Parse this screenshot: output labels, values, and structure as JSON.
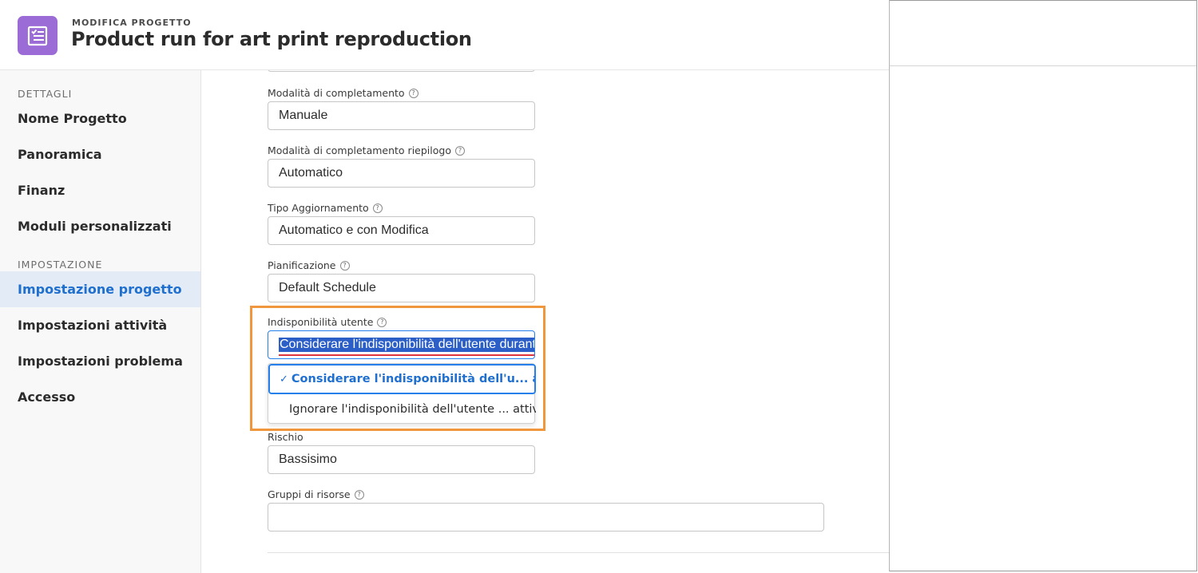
{
  "header": {
    "subtitle": "MODIFICA PROGETTO",
    "title": "Product run for art print reproduction",
    "icon": "task-list-icon",
    "icon_color": "#9b6bd6"
  },
  "sidebar": {
    "sections": [
      {
        "label": "DETTAGLI",
        "items": [
          {
            "label": "Nome Progetto"
          },
          {
            "label": "Panoramica"
          },
          {
            "label": "Finanz"
          },
          {
            "label": "Moduli personalizzati"
          }
        ]
      },
      {
        "label": "IMPOSTAZIONE",
        "items": [
          {
            "label": "Impostazione progetto",
            "active": true
          },
          {
            "label": "Impostazioni attività"
          },
          {
            "label": "Impostazioni problema"
          },
          {
            "label": "Accesso"
          }
        ]
      }
    ],
    "active_color": "#1f6fcf"
  },
  "fields": [
    {
      "label": "Modalità di completamento",
      "value": "Manuale",
      "help": true
    },
    {
      "label": "Modalità di completamento riepilogo",
      "value": "Automatico",
      "help": true
    },
    {
      "label": "Tipo Aggiornamento",
      "value": "Automatico e con Modifica",
      "help": true
    },
    {
      "label": "Pianificazione",
      "value": "Default Schedule",
      "help": true
    },
    {
      "label": "Indisponibilità utente",
      "value": "Considerare l'indisponibilità dell'utente durante",
      "help": true,
      "open": true
    },
    {
      "label": "Rischio",
      "value": "Bassisimo",
      "help": false
    },
    {
      "label": "Gruppi di risorse",
      "value": "",
      "help": true
    }
  ],
  "dropdown": {
    "options": [
      {
        "label": "Considerare l'indisponibilità dell'u... attività",
        "selected": true
      },
      {
        "label": "Ignorare l'indisponibilità dell'utente ... attività",
        "selected": false
      }
    ],
    "check_glyph": "✓"
  },
  "help_glyph": "?",
  "highlight_color": "#f0963c"
}
